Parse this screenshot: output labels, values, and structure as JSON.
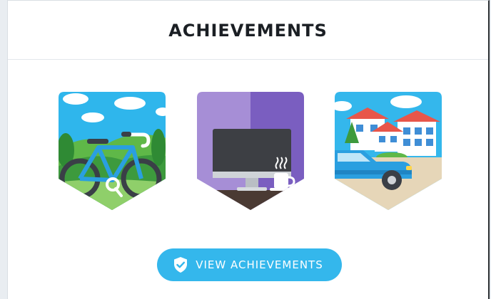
{
  "header": {
    "title": "ACHIEVEMENTS"
  },
  "badges": [
    {
      "icon": "bicycle-badge-icon"
    },
    {
      "icon": "remote-work-desktop-badge-icon"
    },
    {
      "icon": "car-commute-badge-icon"
    }
  ],
  "cta": {
    "label": "VIEW ACHIEVEMENTS",
    "icon": "shield-check-icon"
  },
  "colors": {
    "accent": "#34b7ec",
    "title": "#1b1f24",
    "card_bg": "#ffffff",
    "page_bg": "#e9edf1"
  }
}
